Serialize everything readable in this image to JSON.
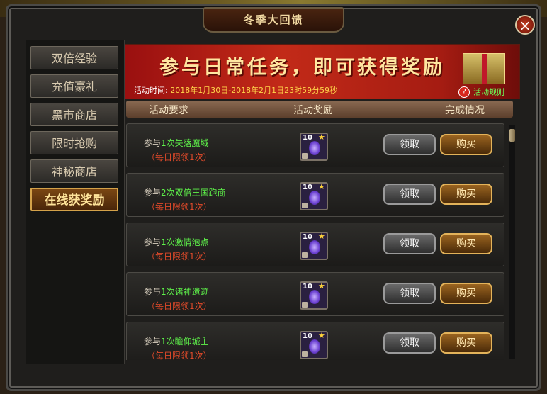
{
  "window": {
    "title": "冬季大回馈",
    "close_symbol": "×"
  },
  "sidebar": {
    "items": [
      {
        "label": "双倍经验",
        "active": false
      },
      {
        "label": "充值豪礼",
        "active": false
      },
      {
        "label": "黑市商店",
        "active": false
      },
      {
        "label": "限时抢购",
        "active": false
      },
      {
        "label": "神秘商店",
        "active": false
      },
      {
        "label": "在线获奖励",
        "active": true
      }
    ]
  },
  "banner": {
    "title": "参与日常任务，即可获得奖励",
    "time_label": "活动时间:",
    "time_value": "2018年1月30日-2018年2月1日23时59分59秒",
    "rules_icon": "?",
    "rules_link": "活动规则"
  },
  "table": {
    "headers": {
      "requirement": "活动要求",
      "reward": "活动奖励",
      "status": "完成情况"
    },
    "rows": [
      {
        "prefix": "参与",
        "highlight": "1次失落魔域",
        "limit": "（每日限领1次）",
        "reward_qty": "10",
        "claim": "领取",
        "buy": "购买"
      },
      {
        "prefix": "参与",
        "highlight": "2次双倍王国跑商",
        "limit": "（每日限领1次）",
        "reward_qty": "10",
        "claim": "领取",
        "buy": "购买"
      },
      {
        "prefix": "参与",
        "highlight": "1次激情泡点",
        "limit": "（每日限领1次）",
        "reward_qty": "10",
        "claim": "领取",
        "buy": "购买"
      },
      {
        "prefix": "参与",
        "highlight": "1次诸神遗迹",
        "limit": "（每日限领1次）",
        "reward_qty": "10",
        "claim": "领取",
        "buy": "购买"
      },
      {
        "prefix": "参与",
        "highlight": "1次瞻仰城主",
        "limit": "（每日限领1次）",
        "reward_qty": "10",
        "claim": "领取",
        "buy": "购买"
      }
    ]
  },
  "icons": {
    "reward_item": "purple-gem-icon",
    "star": "★"
  }
}
